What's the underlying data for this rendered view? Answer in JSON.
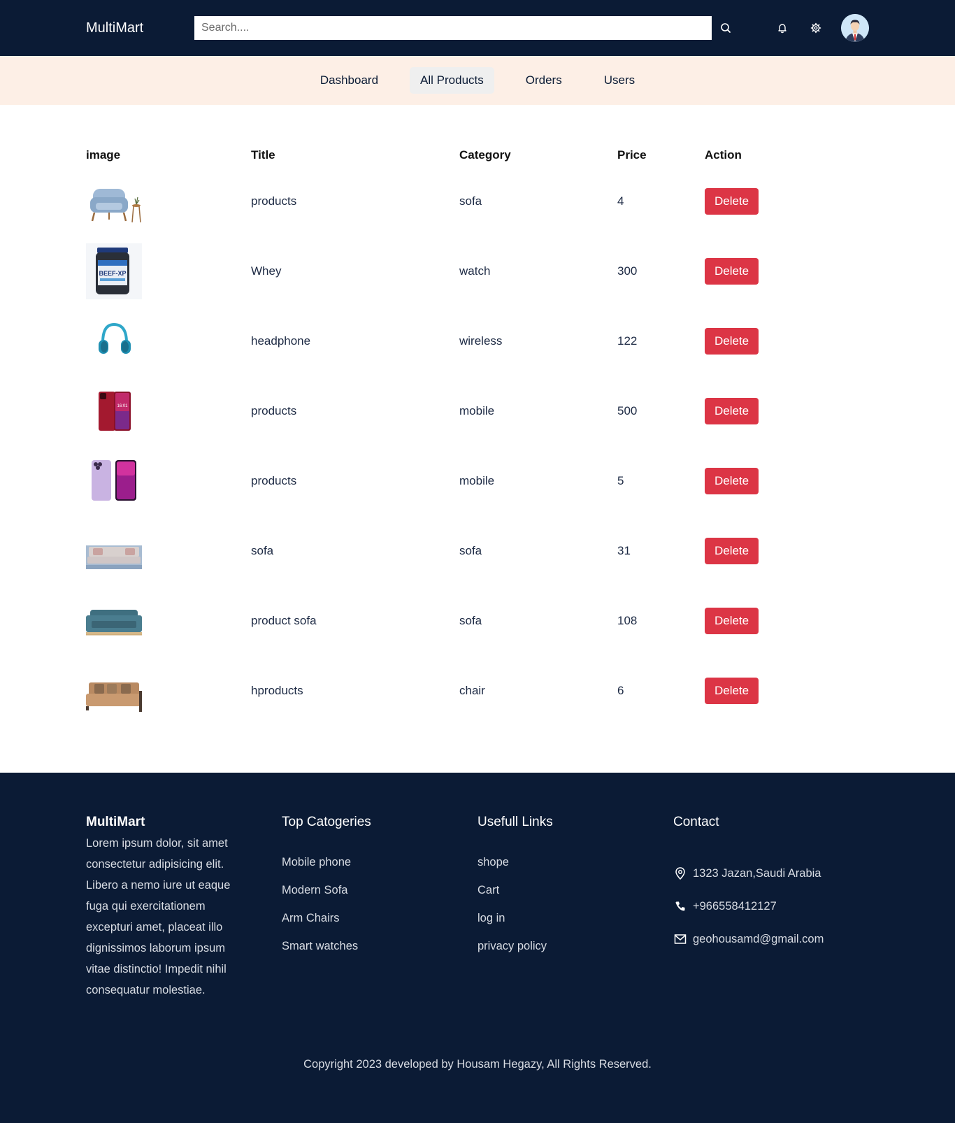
{
  "header": {
    "brand": "MultiMart",
    "search_placeholder": "Search....",
    "icons": [
      "search-icon",
      "bell-icon",
      "gear-icon",
      "avatar"
    ]
  },
  "nav": {
    "items": [
      {
        "label": "Dashboard",
        "active": false
      },
      {
        "label": "All Products",
        "active": true
      },
      {
        "label": "Orders",
        "active": false
      },
      {
        "label": "Users",
        "active": false
      }
    ]
  },
  "table": {
    "headers": [
      "image",
      "Title",
      "Category",
      "Price",
      "Action"
    ],
    "rows": [
      {
        "image": "armchair-image",
        "title": "products",
        "category": "sofa",
        "price": "4",
        "action": "Delete"
      },
      {
        "image": "protein-tub-image",
        "title": "Whey",
        "category": "watch",
        "price": "300",
        "action": "Delete"
      },
      {
        "image": "headphone-image",
        "title": "headphone",
        "category": "wireless",
        "price": "122",
        "action": "Delete"
      },
      {
        "image": "red-phone-image",
        "title": "products",
        "category": "mobile",
        "price": "500",
        "action": "Delete"
      },
      {
        "image": "purple-phones-image",
        "title": "products",
        "category": "mobile",
        "price": "5",
        "action": "Delete"
      },
      {
        "image": "grey-sofa-image",
        "title": "sofa",
        "category": "sofa",
        "price": "31",
        "action": "Delete"
      },
      {
        "image": "teal-sofa-image",
        "title": "product sofa",
        "category": "sofa",
        "price": "108",
        "action": "Delete"
      },
      {
        "image": "brown-sofa-image",
        "title": "hproducts",
        "category": "chair",
        "price": "6",
        "action": "Delete"
      }
    ]
  },
  "footer": {
    "brand": "MultiMart",
    "about": "Lorem ipsum dolor, sit amet consectetur adipisicing elit. Libero a nemo iure ut eaque fuga qui exercitationem excepturi amet, placeat illo dignissimos laborum ipsum vitae distinctio! Impedit nihil consequatur molestiae.",
    "categories_title": "Top Catogeries",
    "categories": [
      "Mobile phone",
      "Modern Sofa",
      "Arm Chairs",
      "Smart watches"
    ],
    "links_title": "Usefull Links",
    "links": [
      "shope",
      "Cart",
      "log in",
      "privacy policy"
    ],
    "contact_title": "Contact",
    "contact": {
      "address": "1323 Jazan,Saudi Arabia",
      "phone": "+966558412127",
      "email": "geohousamd@gmail.com"
    },
    "copyright": "Copyright 2023 developed by Housam Hegazy, All Rights Reserved."
  },
  "colors": {
    "dark_navy": "#0b1b35",
    "nav_bg": "#fdefe6",
    "delete_red": "#dc3545"
  }
}
